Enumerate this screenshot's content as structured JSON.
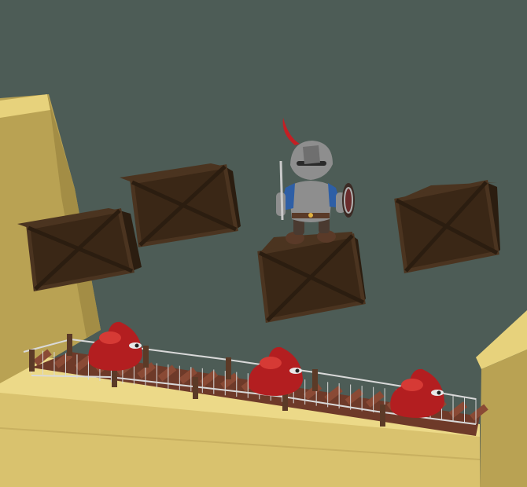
{
  "scene": {
    "colors": {
      "sky": "#4d5c56",
      "cliff_side": "#b9a253",
      "cliff_top": "#e7d27c",
      "ground_front": "#d9c26e",
      "ground_top": "#ecd988",
      "crate_dark": "#2b1d10",
      "crate_mid": "#3a2716",
      "crate_edge": "#4b3420",
      "bridge_plank": "#8a4a35",
      "bridge_plank_dark": "#6e3a29",
      "rope": "#d9d9d9",
      "post": "#5b3a27",
      "slime": "#b31e20",
      "slime_highlight": "#d63a35",
      "knight_armor": "#8e8e8e",
      "knight_blue": "#2e5fa6",
      "knight_plume": "#c31f24",
      "knight_boots": "#5a3a28"
    },
    "crates": [
      "crate",
      "crate",
      "crate",
      "crate"
    ],
    "slimes": [
      "red-slime",
      "red-slime",
      "red-slime"
    ],
    "player": "knight"
  }
}
